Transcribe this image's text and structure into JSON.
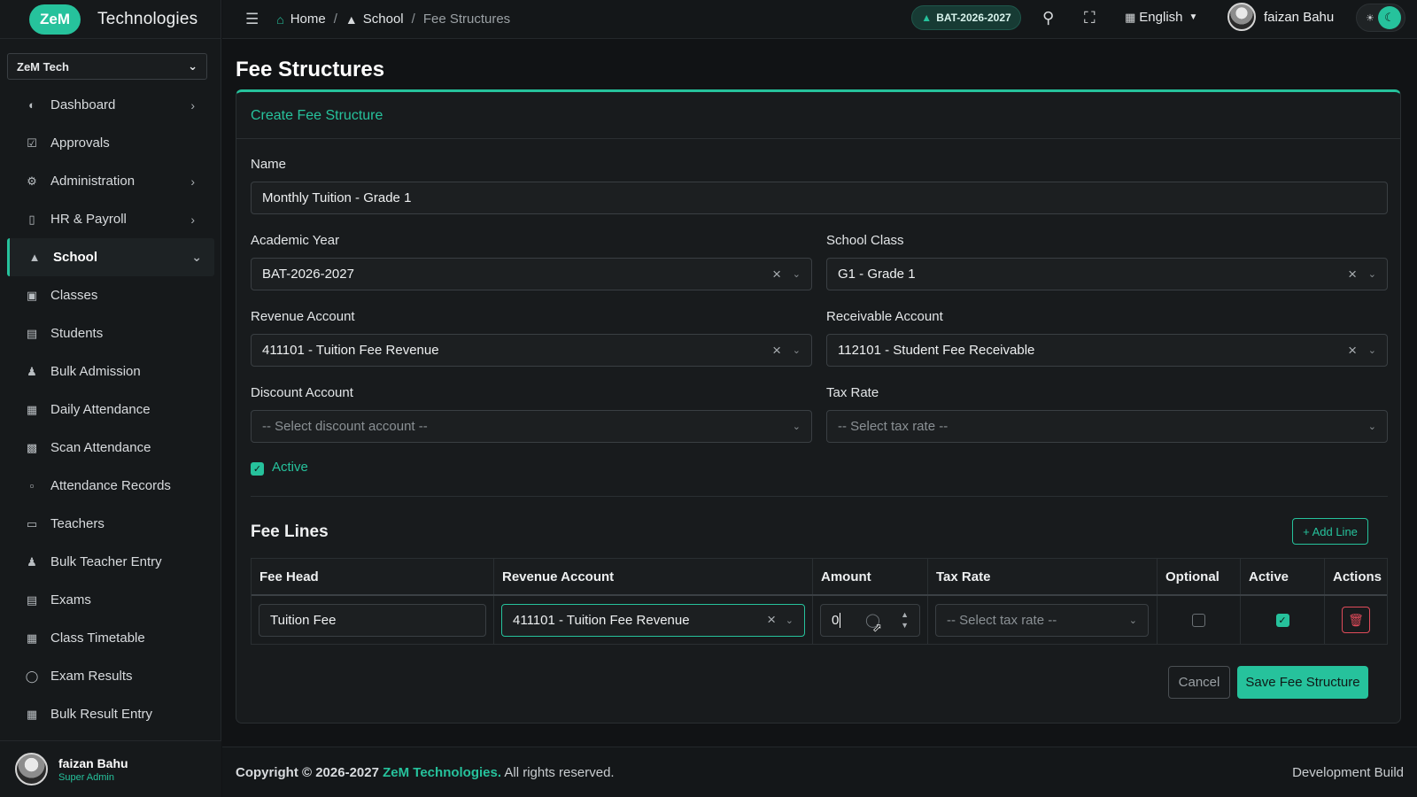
{
  "brand": {
    "logo": "ZeM",
    "name": "Technologies"
  },
  "org_select": {
    "value": "ZeM Tech"
  },
  "sidebar": {
    "items": [
      {
        "label": "Dashboard",
        "icon": "dashboard-icon",
        "has_submenu": true
      },
      {
        "label": "Approvals",
        "icon": "approvals-icon",
        "has_submenu": false
      },
      {
        "label": "Administration",
        "icon": "gear-icon",
        "has_submenu": true
      },
      {
        "label": "HR & Payroll",
        "icon": "badge-icon",
        "has_submenu": true
      },
      {
        "label": "School",
        "icon": "graduation-cap-icon",
        "has_submenu": true,
        "active": true,
        "expanded": true
      },
      {
        "label": "Classes",
        "icon": "chalkboard-icon"
      },
      {
        "label": "Students",
        "icon": "id-card-icon"
      },
      {
        "label": "Bulk Admission",
        "icon": "user-plus-icon"
      },
      {
        "label": "Daily Attendance",
        "icon": "calendar-check-icon"
      },
      {
        "label": "Scan Attendance",
        "icon": "qr-code-icon"
      },
      {
        "label": "Attendance Records",
        "icon": "clipboard-icon"
      },
      {
        "label": "Teachers",
        "icon": "teacher-icon"
      },
      {
        "label": "Bulk Teacher Entry",
        "icon": "user-plus-icon"
      },
      {
        "label": "Exams",
        "icon": "exam-icon"
      },
      {
        "label": "Class Timetable",
        "icon": "calendar-icon"
      },
      {
        "label": "Exam Results",
        "icon": "award-icon"
      },
      {
        "label": "Bulk Result Entry",
        "icon": "grid-icon"
      }
    ],
    "user": {
      "name": "faizan Bahu",
      "role": "Super Admin"
    }
  },
  "topbar": {
    "breadcrumb": {
      "home": "Home",
      "section": "School",
      "current": "Fee Structures",
      "sep": "/"
    },
    "academic_year_badge": "BAT-2026-2027",
    "language": "English",
    "user_name": "faizan Bahu"
  },
  "page": {
    "title": "Fee Structures",
    "card_title": "Create Fee Structure",
    "form": {
      "name_label": "Name",
      "name_value": "Monthly Tuition - Grade 1",
      "academic_year_label": "Academic Year",
      "academic_year_value": "BAT-2026-2027",
      "school_class_label": "School Class",
      "school_class_value": "G1 - Grade 1",
      "revenue_account_label": "Revenue Account",
      "revenue_account_value": "411101 - Tuition Fee Revenue",
      "receivable_account_label": "Receivable Account",
      "receivable_account_value": "112101 - Student Fee Receivable",
      "discount_account_label": "Discount Account",
      "discount_account_placeholder": "-- Select discount account --",
      "tax_rate_label": "Tax Rate",
      "tax_rate_placeholder": "-- Select tax rate --",
      "active_label": "Active",
      "active_checked": true
    },
    "fee_lines": {
      "title": "Fee Lines",
      "add_line_label": "+ Add Line",
      "columns": [
        "Fee Head",
        "Revenue Account",
        "Amount",
        "Tax Rate",
        "Optional",
        "Active",
        "Actions"
      ],
      "rows": [
        {
          "fee_head": "Tuition Fee",
          "revenue_account": "411101 - Tuition Fee Revenue",
          "amount": "0",
          "tax_rate_placeholder": "-- Select tax rate --",
          "optional": false,
          "active": true
        }
      ]
    },
    "buttons": {
      "cancel": "Cancel",
      "save": "Save Fee Structure"
    }
  },
  "footer": {
    "copyright_prefix": "Copyright © 2026-2027",
    "brand": "ZeM Technologies.",
    "rights": "All rights reserved.",
    "build": "Development Build"
  },
  "colors": {
    "accent": "#26c29c",
    "danger": "#e04b5a",
    "background": "#111315"
  }
}
